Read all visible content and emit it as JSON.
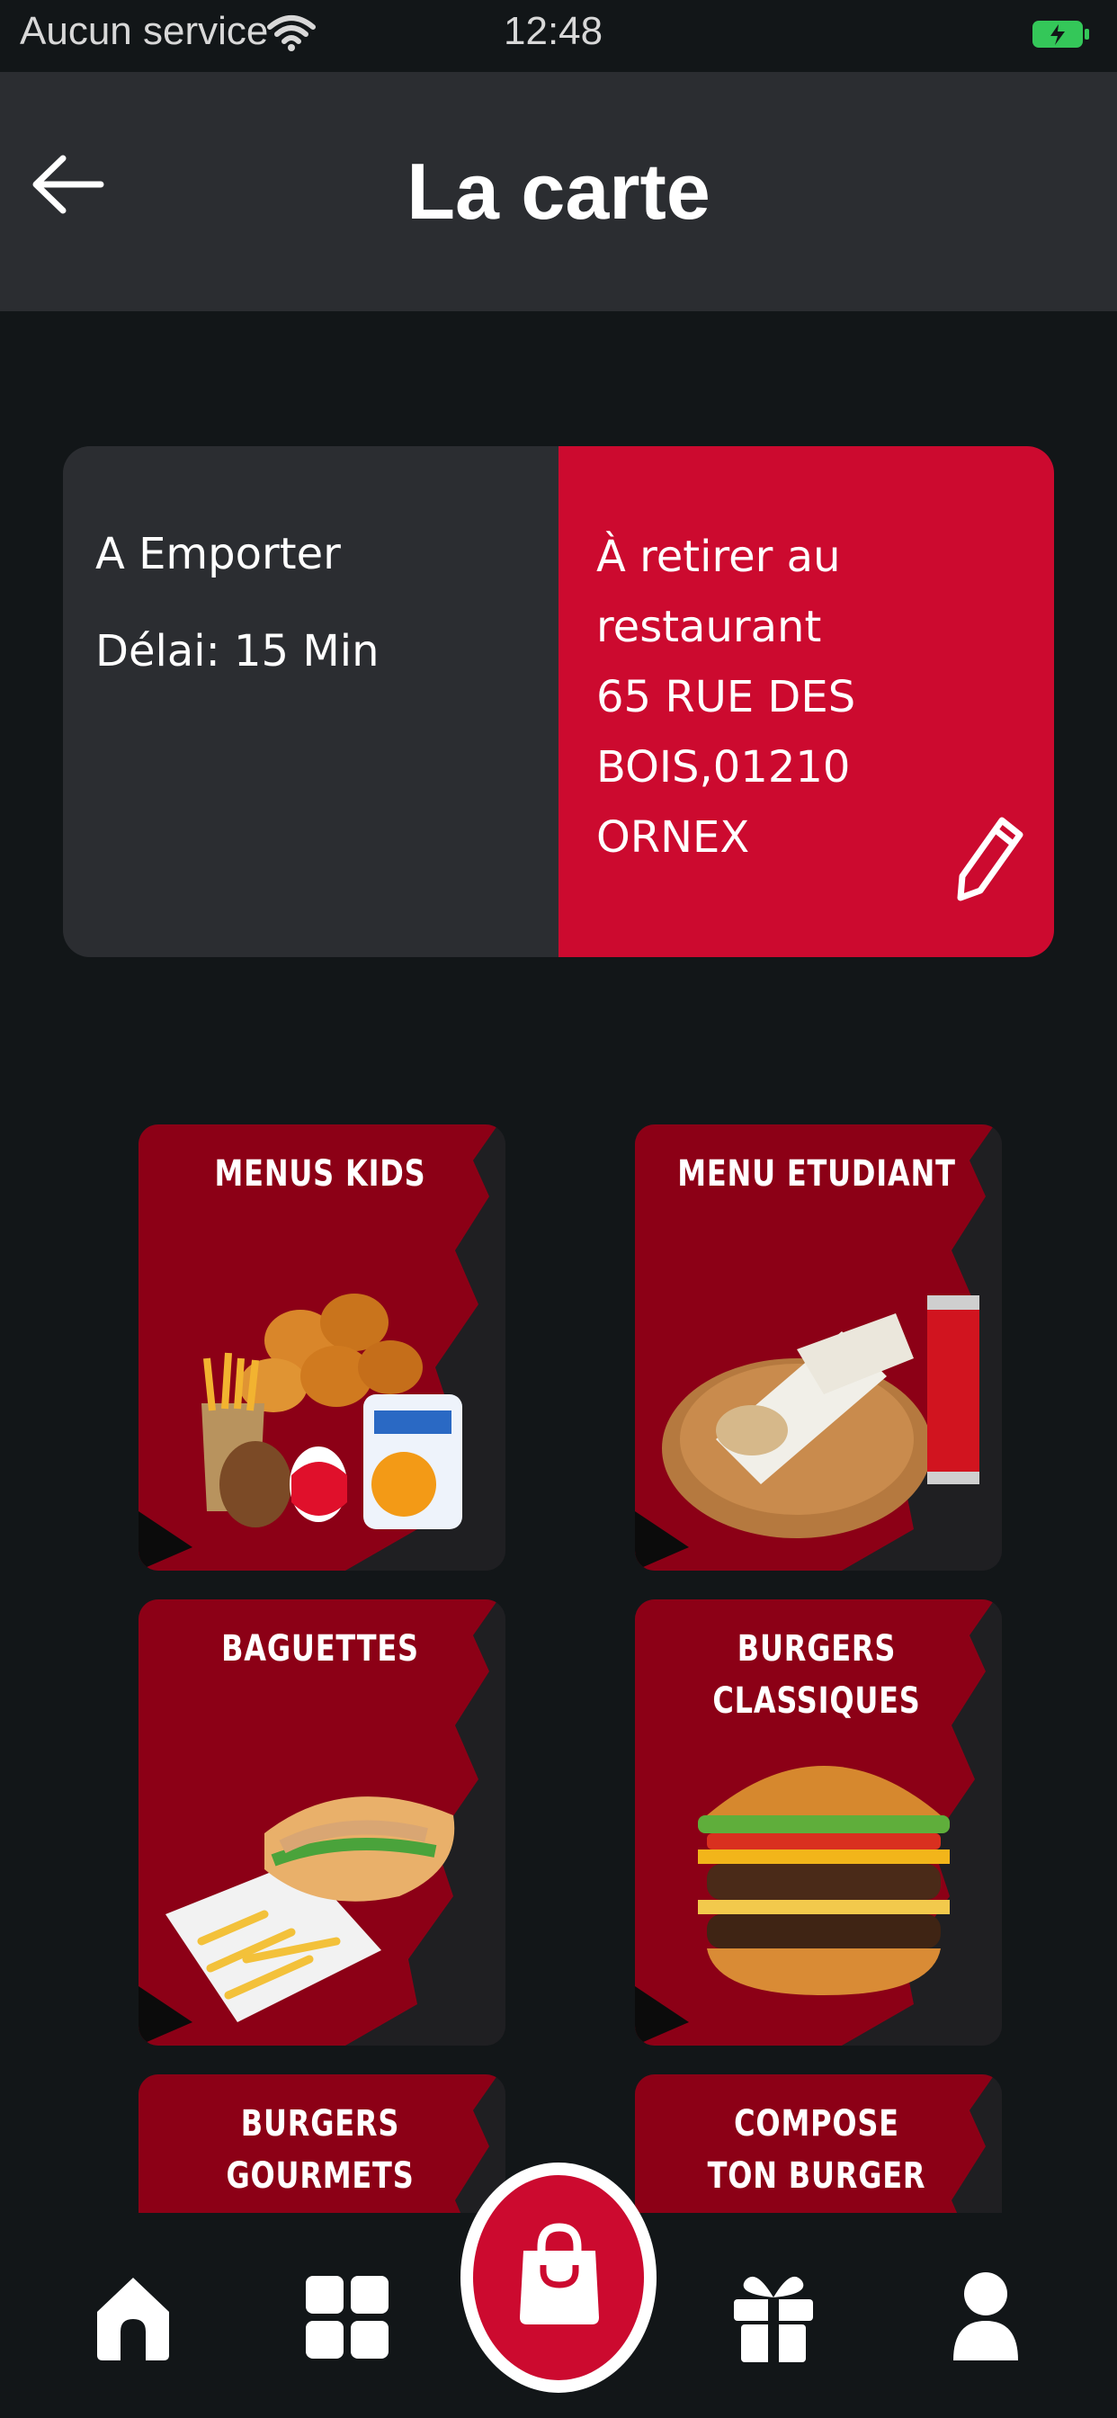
{
  "status_bar": {
    "carrier": "Aucun service",
    "time": "12:48"
  },
  "header": {
    "title": "La carte"
  },
  "order_info": {
    "mode": "A Emporter",
    "delay": "Délai: 15 Min",
    "pickup_label_1": "À retirer au",
    "pickup_label_2": "restaurant",
    "address_1": "65 RUE DES BOIS,01210",
    "address_2": "ORNEX"
  },
  "categories": [
    {
      "line1": "MENUS KIDS",
      "line2": ""
    },
    {
      "line1": "MENU ETUDIANT",
      "line2": ""
    },
    {
      "line1": "BAGUETTES",
      "line2": ""
    },
    {
      "line1": "BURGERS",
      "line2": "CLASSIQUES"
    },
    {
      "line1": "BURGERS",
      "line2": "GOURMETS"
    },
    {
      "line1": "COMPOSE",
      "line2": "TON BURGER"
    }
  ],
  "nav": [
    "home-icon",
    "grid-icon",
    "shopping-bag-icon",
    "gift-icon",
    "user-icon"
  ],
  "colors": {
    "accent": "#cc0a2f",
    "tile_red": "#8c0016",
    "background": "#121618",
    "header": "#2b2d31"
  }
}
